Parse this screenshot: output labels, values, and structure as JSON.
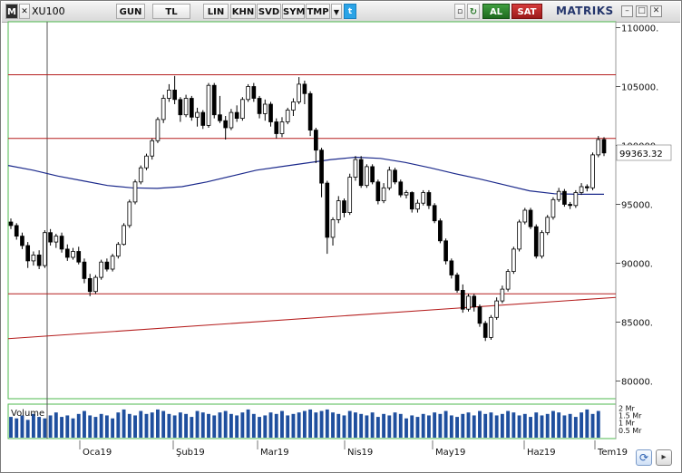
{
  "toolbar": {
    "menu_label": "M",
    "symbol": "XU100",
    "buttons": [
      "GUN",
      "TL",
      "LIN",
      "KHN",
      "SVD",
      "SYM",
      "TMP"
    ],
    "buy_label": "AL",
    "sell_label": "SAT",
    "brand": "MATRIKS"
  },
  "chart_data": {
    "type": "candlestick",
    "symbol": "XU100",
    "price_axis": {
      "ticks": [
        "110000.",
        "105000.",
        "100000.",
        "95000.",
        "90000.",
        "85000.",
        "80000."
      ],
      "ylim": [
        78500,
        110500
      ]
    },
    "last_price": 99363.32,
    "last_price_label": "99363.32",
    "x_labels": [
      "Oca19",
      "Şub19",
      "Mar19",
      "Nis19",
      "May19",
      "Haz19",
      "Tem19"
    ],
    "horizontal_lines": [
      106000,
      100600,
      87400
    ],
    "trendline": {
      "start": 83600,
      "end": 87100
    },
    "moving_average": [
      98300,
      97900,
      97400,
      97000,
      96600,
      96400,
      96350,
      96500,
      96900,
      97400,
      97900,
      98200,
      98500,
      98800,
      99000,
      98900,
      98550,
      98100,
      97600,
      97150,
      96650,
      96150,
      95900,
      95850,
      95850
    ],
    "ohlc": [
      [
        93500,
        93800,
        92900,
        93200
      ],
      [
        93200,
        93400,
        92000,
        92300
      ],
      [
        92300,
        92600,
        91200,
        91500
      ],
      [
        91500,
        91800,
        89600,
        90200
      ],
      [
        90200,
        91000,
        89800,
        90700
      ],
      [
        90700,
        91100,
        89500,
        89800
      ],
      [
        89800,
        92800,
        89600,
        92600
      ],
      [
        92600,
        92900,
        91500,
        91800
      ],
      [
        91800,
        92500,
        91300,
        92300
      ],
      [
        92300,
        92600,
        90900,
        91200
      ],
      [
        91200,
        91600,
        90200,
        90500
      ],
      [
        90500,
        91300,
        90300,
        91000
      ],
      [
        91000,
        91400,
        89900,
        90100
      ],
      [
        90100,
        90400,
        88300,
        88700
      ],
      [
        88700,
        89100,
        87200,
        87600
      ],
      [
        87600,
        89000,
        87400,
        88800
      ],
      [
        88800,
        90300,
        88600,
        90100
      ],
      [
        90100,
        90400,
        89300,
        89500
      ],
      [
        89500,
        90800,
        89300,
        90600
      ],
      [
        90600,
        91800,
        90400,
        91600
      ],
      [
        91600,
        93400,
        91500,
        93200
      ],
      [
        93200,
        95400,
        93000,
        95200
      ],
      [
        95200,
        97100,
        95000,
        96900
      ],
      [
        96900,
        98300,
        96700,
        98100
      ],
      [
        98100,
        99300,
        97900,
        99100
      ],
      [
        99100,
        100600,
        98800,
        100400
      ],
      [
        100400,
        102400,
        100200,
        102200
      ],
      [
        102200,
        104300,
        101900,
        104000
      ],
      [
        104000,
        105200,
        103700,
        104700
      ],
      [
        104700,
        105900,
        103500,
        103900
      ],
      [
        103900,
        104100,
        102000,
        102600
      ],
      [
        102600,
        104300,
        102400,
        104000
      ],
      [
        104000,
        104200,
        102100,
        102400
      ],
      [
        102400,
        103200,
        101600,
        102800
      ],
      [
        102800,
        103000,
        101400,
        101700
      ],
      [
        101700,
        105300,
        101500,
        105100
      ],
      [
        105100,
        105300,
        102300,
        102600
      ],
      [
        102600,
        104200,
        101900,
        102100
      ],
      [
        102100,
        102500,
        100500,
        101500
      ],
      [
        101500,
        103100,
        101300,
        102800
      ],
      [
        102800,
        103400,
        102000,
        102300
      ],
      [
        102300,
        104100,
        102100,
        103900
      ],
      [
        103900,
        105200,
        103700,
        105000
      ],
      [
        105000,
        105300,
        103700,
        104000
      ],
      [
        104000,
        104200,
        102300,
        102700
      ],
      [
        102700,
        103900,
        102100,
        103500
      ],
      [
        103500,
        103700,
        101600,
        102000
      ],
      [
        102000,
        102300,
        100600,
        101000
      ],
      [
        101000,
        102400,
        100700,
        102000
      ],
      [
        102000,
        103200,
        101800,
        103000
      ],
      [
        103000,
        104000,
        102500,
        103700
      ],
      [
        103700,
        105800,
        103500,
        105200
      ],
      [
        105200,
        105500,
        103500,
        104400
      ],
      [
        104400,
        104600,
        100800,
        101300
      ],
      [
        101300,
        101500,
        98500,
        99600
      ],
      [
        99600,
        99800,
        95600,
        96800
      ],
      [
        96800,
        97000,
        90800,
        92200
      ],
      [
        92200,
        93900,
        91500,
        93700
      ],
      [
        93700,
        95700,
        93400,
        95300
      ],
      [
        95300,
        95500,
        93900,
        94300
      ],
      [
        94300,
        97600,
        94100,
        97300
      ],
      [
        97300,
        99100,
        97000,
        98800
      ],
      [
        98800,
        99100,
        96400,
        96600
      ],
      [
        96600,
        98400,
        96400,
        98200
      ],
      [
        98200,
        98400,
        96700,
        96900
      ],
      [
        96900,
        97100,
        95000,
        95300
      ],
      [
        95300,
        96800,
        95100,
        96400
      ],
      [
        96400,
        98200,
        96200,
        97900
      ],
      [
        97900,
        98100,
        96700,
        96900
      ],
      [
        96900,
        97100,
        95600,
        95800
      ],
      [
        95800,
        96200,
        95500,
        96000
      ],
      [
        96000,
        96100,
        94300,
        94600
      ],
      [
        94600,
        95400,
        94300,
        95100
      ],
      [
        95100,
        96200,
        94900,
        96000
      ],
      [
        96000,
        96200,
        94600,
        94900
      ],
      [
        94900,
        95100,
        93400,
        93600
      ],
      [
        93600,
        93800,
        91700,
        91900
      ],
      [
        91900,
        92100,
        89900,
        90200
      ],
      [
        90200,
        90400,
        88700,
        89000
      ],
      [
        89000,
        89200,
        87500,
        87700
      ],
      [
        87700,
        88200,
        85800,
        86100
      ],
      [
        86100,
        87400,
        85900,
        87200
      ],
      [
        87200,
        87400,
        85900,
        86300
      ],
      [
        86300,
        86500,
        84600,
        84900
      ],
      [
        84900,
        85100,
        83400,
        83700
      ],
      [
        83700,
        85600,
        83500,
        85400
      ],
      [
        85400,
        87100,
        85200,
        86800
      ],
      [
        86800,
        88100,
        86600,
        87800
      ],
      [
        87800,
        89500,
        87600,
        89300
      ],
      [
        89300,
        91400,
        89100,
        91200
      ],
      [
        91200,
        93700,
        91000,
        93500
      ],
      [
        93500,
        94700,
        93300,
        94500
      ],
      [
        94500,
        94700,
        92900,
        93100
      ],
      [
        93100,
        93300,
        90400,
        90600
      ],
      [
        90600,
        92800,
        90400,
        92600
      ],
      [
        92600,
        94100,
        92400,
        93900
      ],
      [
        93900,
        95600,
        93700,
        95400
      ],
      [
        95400,
        96400,
        95200,
        96100
      ],
      [
        96100,
        96300,
        94800,
        95000
      ],
      [
        95000,
        95200,
        94600,
        94900
      ],
      [
        94900,
        96200,
        94700,
        96000
      ],
      [
        96000,
        96800,
        95800,
        96500
      ],
      [
        96500,
        96700,
        96100,
        96400
      ],
      [
        96400,
        99400,
        96200,
        99200
      ],
      [
        99200,
        100800,
        99000,
        100500
      ],
      [
        100500,
        100700,
        99100,
        99363
      ]
    ],
    "volume_panel": {
      "label": "Volume",
      "ticks": [
        "2 Mr",
        "1.5 Mr",
        "1 Mr",
        "0.5 Mr"
      ],
      "ylim": [
        0,
        2.2
      ]
    },
    "volume": [
      1.4,
      1.3,
      1.5,
      1.2,
      1.6,
      1.4,
      1.3,
      1.5,
      1.7,
      1.4,
      1.5,
      1.3,
      1.6,
      1.8,
      1.5,
      1.4,
      1.6,
      1.5,
      1.3,
      1.7,
      1.9,
      1.6,
      1.5,
      1.8,
      1.6,
      1.7,
      1.9,
      1.8,
      1.6,
      1.5,
      1.7,
      1.6,
      1.4,
      1.8,
      1.7,
      1.6,
      1.5,
      1.7,
      1.8,
      1.6,
      1.5,
      1.7,
      1.9,
      1.6,
      1.4,
      1.5,
      1.7,
      1.6,
      1.8,
      1.5,
      1.6,
      1.7,
      1.8,
      1.9,
      1.7,
      1.8,
      1.9,
      1.7,
      1.6,
      1.5,
      1.8,
      1.7,
      1.6,
      1.5,
      1.7,
      1.4,
      1.6,
      1.5,
      1.7,
      1.6,
      1.3,
      1.5,
      1.4,
      1.6,
      1.5,
      1.7,
      1.6,
      1.8,
      1.5,
      1.4,
      1.6,
      1.7,
      1.5,
      1.8,
      1.6,
      1.7,
      1.5,
      1.6,
      1.8,
      1.7,
      1.5,
      1.6,
      1.4,
      1.7,
      1.5,
      1.6,
      1.8,
      1.7,
      1.5,
      1.6,
      1.4,
      1.7,
      1.9,
      1.6,
      1.8
    ]
  },
  "colors": {
    "up_body": "#ffffff",
    "down_body": "#000000",
    "ma_line": "#1c2a8c",
    "level_line": "#b51e1e",
    "volume_bar": "#1f4f9e",
    "grid_border": "#4fb84f"
  }
}
